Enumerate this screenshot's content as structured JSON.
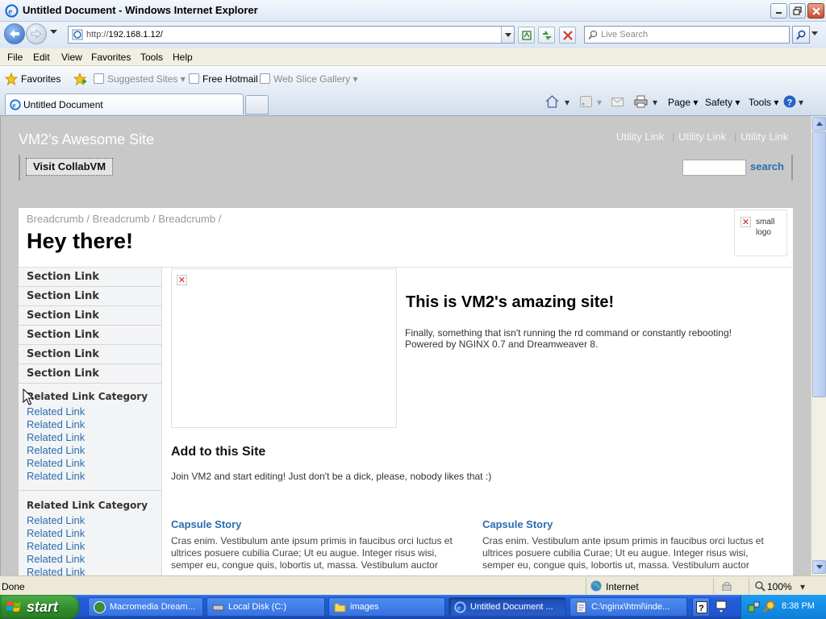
{
  "window": {
    "title": "Untitled Document - Windows Internet Explorer"
  },
  "address": {
    "url_prefix": "http://",
    "url_host": "192.168.1.12/",
    "search_placeholder": "Live Search"
  },
  "menu": {
    "items": [
      "File",
      "Edit",
      "View",
      "Favorites",
      "Tools",
      "Help"
    ]
  },
  "favorites_bar": {
    "favorites": "Favorites",
    "suggested": "Suggested Sites",
    "hotmail": "Free Hotmail",
    "slice": "Web Slice Gallery"
  },
  "tab": {
    "active_label": "Untitled Document"
  },
  "command_bar": {
    "page": "Page",
    "safety": "Safety",
    "tools": "Tools"
  },
  "site": {
    "title": "VM2's Awesome Site",
    "utility_links": [
      "Utility Link",
      "Utility Link",
      "Utility Link"
    ],
    "collab_button": "Visit CollabVM",
    "search_button": "search",
    "breadcrumbs": "Breadcrumb / Breadcrumb / Breadcrumb /",
    "heading": "Hey there!",
    "logo_alt": "small logo",
    "section_links": [
      "Section Link",
      "Section Link",
      "Section Link",
      "Section Link",
      "Section Link",
      "Section Link"
    ],
    "related_categories": [
      {
        "title": "Related Link Category",
        "links": [
          "Related Link",
          "Related Link",
          "Related Link",
          "Related Link",
          "Related Link",
          "Related Link"
        ]
      },
      {
        "title": "Related Link Category",
        "links": [
          "Related Link",
          "Related Link",
          "Related Link",
          "Related Link",
          "Related Link"
        ]
      }
    ],
    "hero_heading": "This is VM2's amazing site!",
    "hero_text": "Finally, something that isn't running the rd command or constantly rebooting! Powered by NGINX 0.7 and Dreamweaver 8.",
    "add_heading": "Add to this Site",
    "add_text": "Join VM2 and start editing! Just don't be a dick, please, nobody likes that :)",
    "capsules": [
      {
        "title": "Capsule Story",
        "text": "Cras enim. Vestibulum ante ipsum primis in faucibus orci luctus et ultrices posuere cubilia Curae; Ut eu augue. Integer risus wisi, semper eu, congue quis, lobortis ut, massa. Vestibulum auctor"
      },
      {
        "title": "Capsule Story",
        "text": "Cras enim. Vestibulum ante ipsum primis in faucibus orci luctus et ultrices posuere cubilia Curae; Ut eu augue. Integer risus wisi, semper eu, congue quis, lobortis ut, massa. Vestibulum auctor"
      }
    ]
  },
  "status": {
    "text": "Done",
    "zone": "Internet",
    "zoom": "100%"
  },
  "taskbar": {
    "start": "start",
    "tasks": [
      "Macromedia Dream...",
      "Local Disk (C:)",
      "images",
      "Untitled Document ...",
      "C:\\nginx\\html\\inde..."
    ],
    "clock": "8:38 PM"
  },
  "colors": {
    "page_bg": "#c8c8c8",
    "link": "#2a6db0",
    "taskbar": "#245edb"
  },
  "icons": [
    "ie-icon",
    "back-arrow-icon",
    "forward-arrow-icon",
    "page-icon",
    "compat-view-icon",
    "refresh-icon",
    "stop-icon",
    "search-icon",
    "star-icon",
    "home-icon",
    "rss-icon",
    "mail-icon",
    "print-icon",
    "help-icon",
    "broken-image-icon",
    "windows-flag-icon",
    "globe-icon",
    "zoom-icon"
  ]
}
